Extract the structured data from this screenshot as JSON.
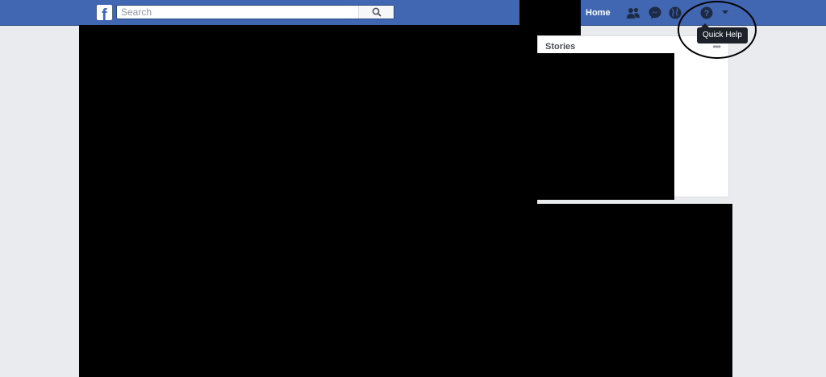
{
  "header": {
    "logo_letter": "f",
    "search": {
      "placeholder": "Search",
      "value": ""
    },
    "home_label": "Home",
    "icons": [
      "friend-requests-icon",
      "messenger-icon",
      "notifications-globe-icon",
      "quick-help-icon",
      "account-menu-caret-icon"
    ]
  },
  "tooltip": {
    "text": "Quick Help"
  },
  "stories": {
    "title": "Stories",
    "more": "•••"
  },
  "colors": {
    "topbar": "#4267b2",
    "page_background": "#e9ebee",
    "redaction": "#000000",
    "tooltip_background": "#1d2129"
  }
}
